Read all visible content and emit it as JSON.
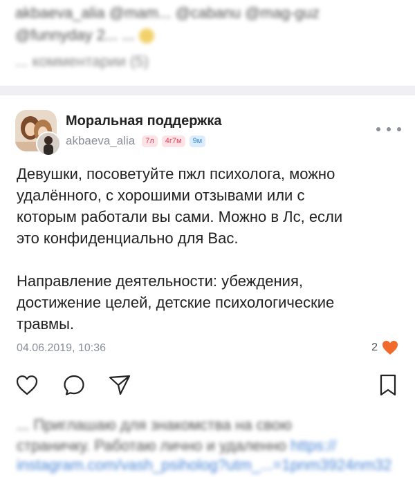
{
  "previous_post": {
    "line1": "akbaeva_alia @mam... @cabanu @mag-guz",
    "line2": "@funnyday 2... ...",
    "comments_link": "... комментарии (5)"
  },
  "post": {
    "community_name": "Моральная поддержка",
    "author": "akbaeva_alia",
    "badges": [
      "7л",
      "4г7м",
      "9м"
    ],
    "text": "Девушки, посоветуйте пжл психолога, можно\nудалённого, с хорошими отзывами или с\nкоторым работали вы сами. Можно в Лс, если\nэто конфиденциально для Вас.\n\nНаправление деятельности: убеждения,\nдостижение целей, детские психологические\nтравмы.",
    "date": "04.06.2019, 10:36",
    "likes_count": "2",
    "colors": {
      "heart": "#f06a2b",
      "link": "#4a86d6",
      "muted": "#8a8f99"
    }
  },
  "icons": [
    "like-outline-icon",
    "comment-icon",
    "share-icon",
    "bookmark-icon",
    "heart-filled-icon",
    "more-icon"
  ],
  "next_post": {
    "line1": "... Приглашаю для знакомства на свою",
    "line2": "страничку. Работаю лично и удаленно",
    "link_inline": "https://",
    "line3": "instagram.com/vash_psiholog?utm_...=1pnm3924nm32"
  }
}
